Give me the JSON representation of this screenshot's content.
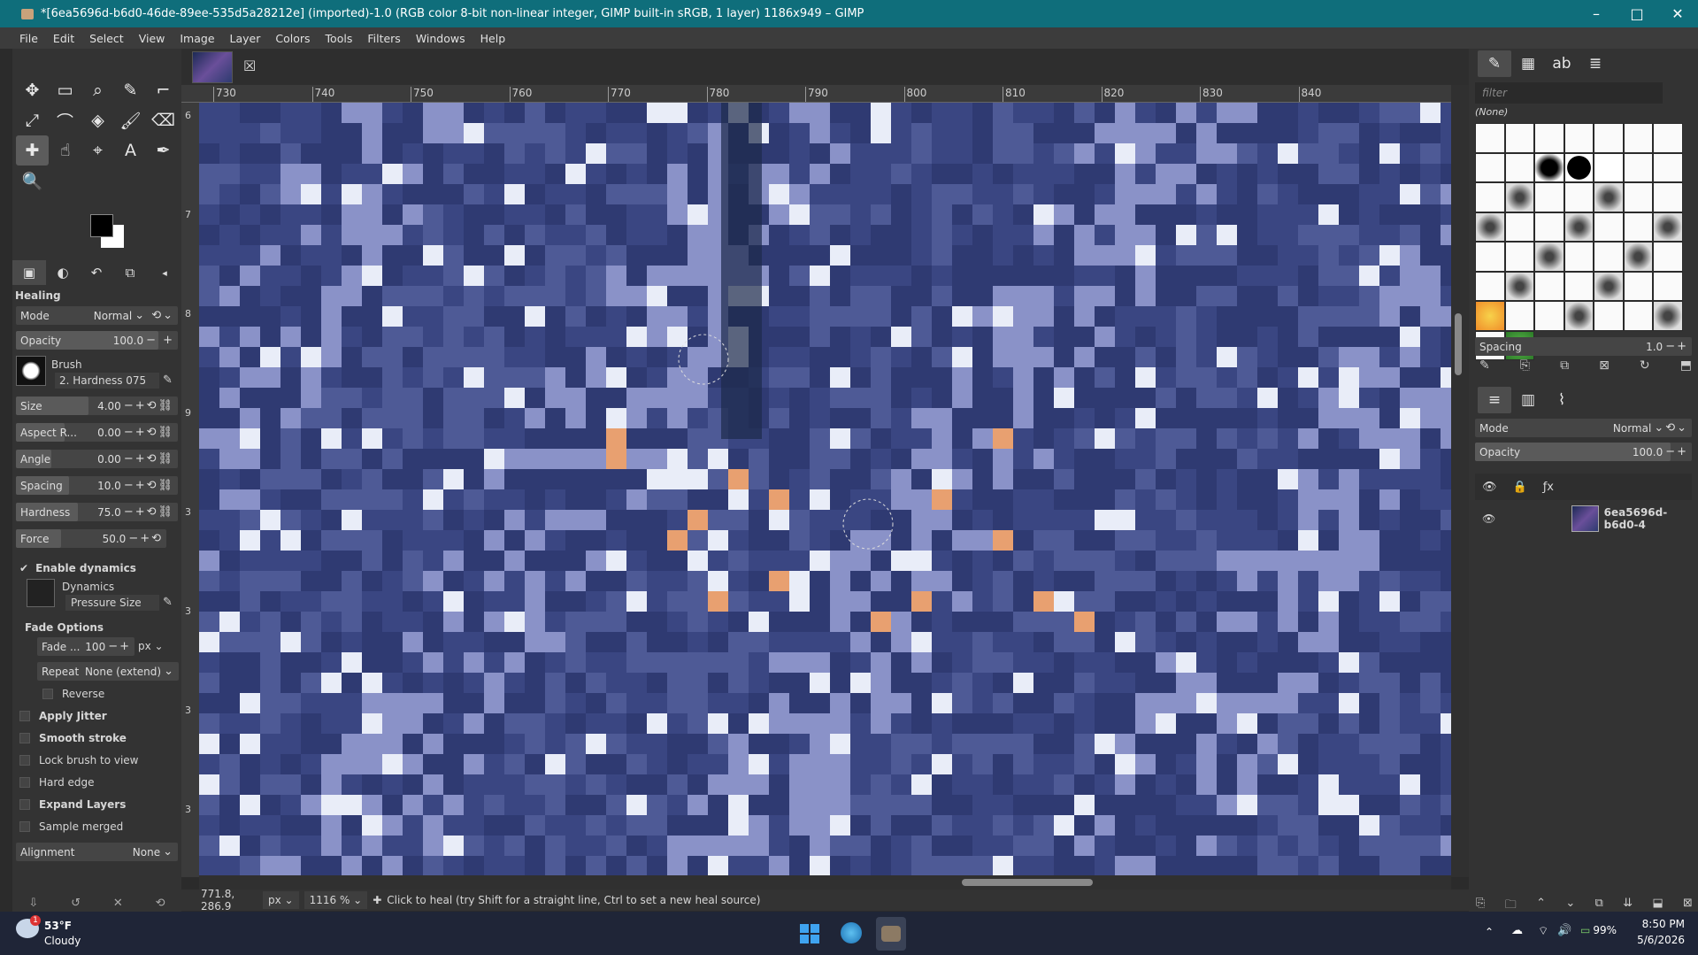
{
  "window": {
    "title": "*[6ea5696d-b6d0-46de-89ee-535d5a28212e] (imported)-1.0 (RGB color 8-bit non-linear integer, GIMP built-in sRGB, 1 layer) 1186x949 – GIMP",
    "minimize": "–",
    "maximize": "□",
    "close": "✕"
  },
  "menu": [
    "File",
    "Edit",
    "Select",
    "View",
    "Image",
    "Layer",
    "Colors",
    "Tools",
    "Filters",
    "Windows",
    "Help"
  ],
  "toolbox": {
    "tools": [
      {
        "name": "move-tool-icon",
        "glyph": "✥"
      },
      {
        "name": "rect-select-icon",
        "glyph": "▭"
      },
      {
        "name": "free-select-icon",
        "glyph": "⌕"
      },
      {
        "name": "fuzzy-select-icon",
        "glyph": "✎"
      },
      {
        "name": "crop-icon",
        "glyph": "⌐"
      },
      {
        "name": "transform-icon",
        "glyph": "⤢"
      },
      {
        "name": "warp-icon",
        "glyph": "⌒"
      },
      {
        "name": "bucket-fill-icon",
        "glyph": "◈"
      },
      {
        "name": "paintbrush-icon",
        "glyph": "🖌"
      },
      {
        "name": "eraser-icon",
        "glyph": "⌫"
      },
      {
        "name": "heal-icon",
        "glyph": "✚"
      },
      {
        "name": "smudge-icon",
        "glyph": "☝"
      },
      {
        "name": "paths-icon",
        "glyph": "⌖"
      },
      {
        "name": "text-tool-icon",
        "glyph": "A"
      },
      {
        "name": "color-picker-icon",
        "glyph": "✒"
      },
      {
        "name": "zoom-icon",
        "glyph": "🔍"
      }
    ]
  },
  "tool_options": {
    "title": "Healing",
    "mode_label": "Mode",
    "mode_value": "Normal",
    "opacity_label": "Opacity",
    "opacity_value": "100.0",
    "brush_label": "Brush",
    "brush_value": "2. Hardness 075",
    "size_label": "Size",
    "size_value": "4.00",
    "aspect_label": "Aspect R...",
    "aspect_value": "0.00",
    "angle_label": "Angle",
    "angle_value": "0.00",
    "spacing_label": "Spacing",
    "spacing_value": "10.0",
    "hardness_label": "Hardness",
    "hardness_value": "75.0",
    "force_label": "Force",
    "force_value": "50.0",
    "enable_dynamics": "Enable dynamics",
    "dynamics_label": "Dynamics",
    "dynamics_value": "Pressure Size",
    "fade_options": "Fade Options",
    "fade_label": "Fade ...",
    "fade_value": "100",
    "fade_unit": "px",
    "repeat_label": "Repeat",
    "repeat_value": "None (extend)",
    "reverse": "Reverse",
    "apply_jitter": "Apply Jitter",
    "smooth_stroke": "Smooth stroke",
    "lock_brush": "Lock brush to view",
    "hard_edge": "Hard edge",
    "expand_layers": "Expand Layers",
    "sample_merged": "Sample merged",
    "alignment_label": "Alignment",
    "alignment_value": "None"
  },
  "ruler_top": [
    "730",
    "740",
    "750",
    "760",
    "770",
    "780",
    "790",
    "800",
    "810",
    "820",
    "830",
    "840"
  ],
  "ruler_left": [
    "6",
    "7",
    "8",
    "9",
    "3",
    "3",
    "3",
    "3"
  ],
  "status": {
    "coords": "771.8, 286.9",
    "unit": "px",
    "zoom": "1116 %",
    "message": "Click to heal (try Shift for a straight line, Ctrl to set a new heal source)"
  },
  "brushes_panel": {
    "filter_placeholder": "filter",
    "selected": "(None)",
    "spacing_label": "Spacing",
    "spacing_value": "1.0"
  },
  "layers_panel": {
    "mode_label": "Mode",
    "mode_value": "Normal",
    "opacity_label": "Opacity",
    "opacity_value": "100.0",
    "layer_name": "6ea5696d-b6d0-4"
  },
  "taskbar": {
    "weather_temp": "53°F",
    "weather_desc": "Cloudy",
    "weather_badge": "1",
    "battery": "99%",
    "time": "8:50 PM",
    "date": "5/6/2026"
  }
}
